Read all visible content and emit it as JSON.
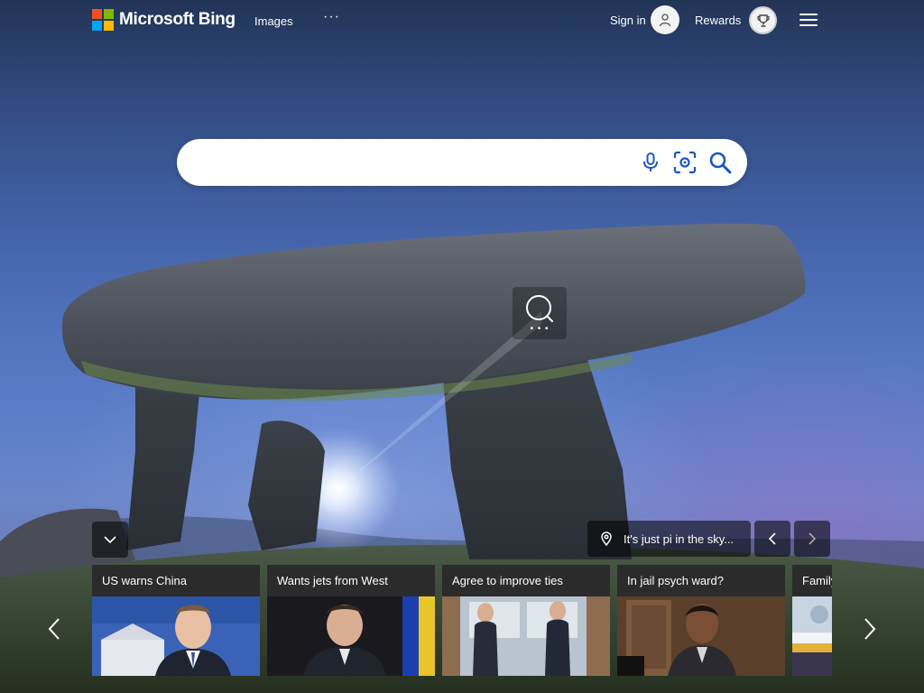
{
  "header": {
    "brand": "Microsoft Bing",
    "nav_images": "Images",
    "nav_more": "···",
    "signin_label": "Sign in",
    "rewards_label": "Rewards",
    "icons": {
      "avatar": "person-icon",
      "rewards": "trophy-icon",
      "menu": "hamburger-menu-icon"
    }
  },
  "brand_colors": {
    "red": "#f25022",
    "green": "#7fba00",
    "blue": "#00a4ef",
    "yellow": "#ffb900"
  },
  "search": {
    "value": "",
    "placeholder": "",
    "icons": {
      "voice": "microphone-icon",
      "visual": "visual-search-icon",
      "submit": "search-icon"
    }
  },
  "lens": {
    "dots": "• • •",
    "icon": "visual-search-icon"
  },
  "image_info": {
    "location_text": "It's just pi in the sky...",
    "icons": {
      "location": "location-pin-icon",
      "prev": "chevron-left-icon",
      "next": "chevron-right-icon",
      "collapse": "chevron-down-icon"
    }
  },
  "news": {
    "items": [
      {
        "title": "US warns China"
      },
      {
        "title": "Wants jets from West"
      },
      {
        "title": "Agree to improve ties"
      },
      {
        "title": "In jail psych ward?"
      },
      {
        "title": "Family"
      }
    ],
    "icons": {
      "prev": "chevron-left-icon",
      "next": "chevron-right-icon"
    }
  }
}
